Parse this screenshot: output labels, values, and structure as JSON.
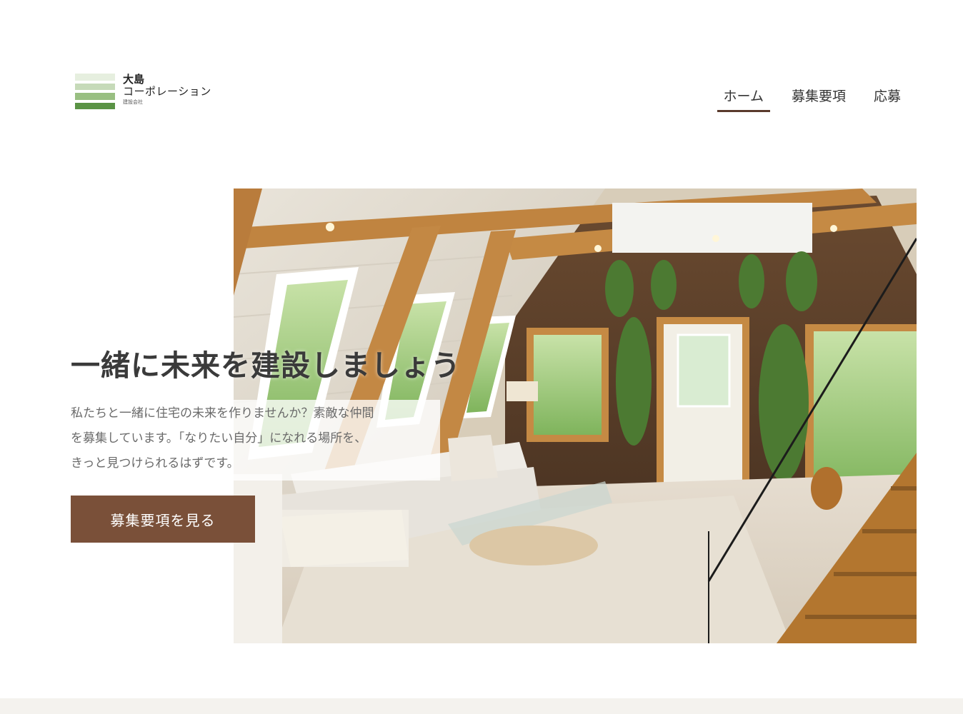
{
  "logo": {
    "line1": "大島",
    "line2": "コーポレーション",
    "line3": "建設会社"
  },
  "nav": {
    "items": [
      "ホーム",
      "募集要項",
      "応募"
    ],
    "active": "ホーム"
  },
  "hero": {
    "title": "一緒に未来を建設しましょう",
    "description": [
      "私たちと一緒に住宅の未来を作りませんか？素敵な仲間",
      "を募集しています。「なりたい自分」になれる場所を、",
      "きっと見つけられるはずです。"
    ],
    "cta_label": "募集要項を見る",
    "image_icon": "interior-photo"
  },
  "colors": {
    "accent": "#7a5039",
    "nav_underline": "#5a3a2c",
    "logo_green": "#5a9345"
  }
}
